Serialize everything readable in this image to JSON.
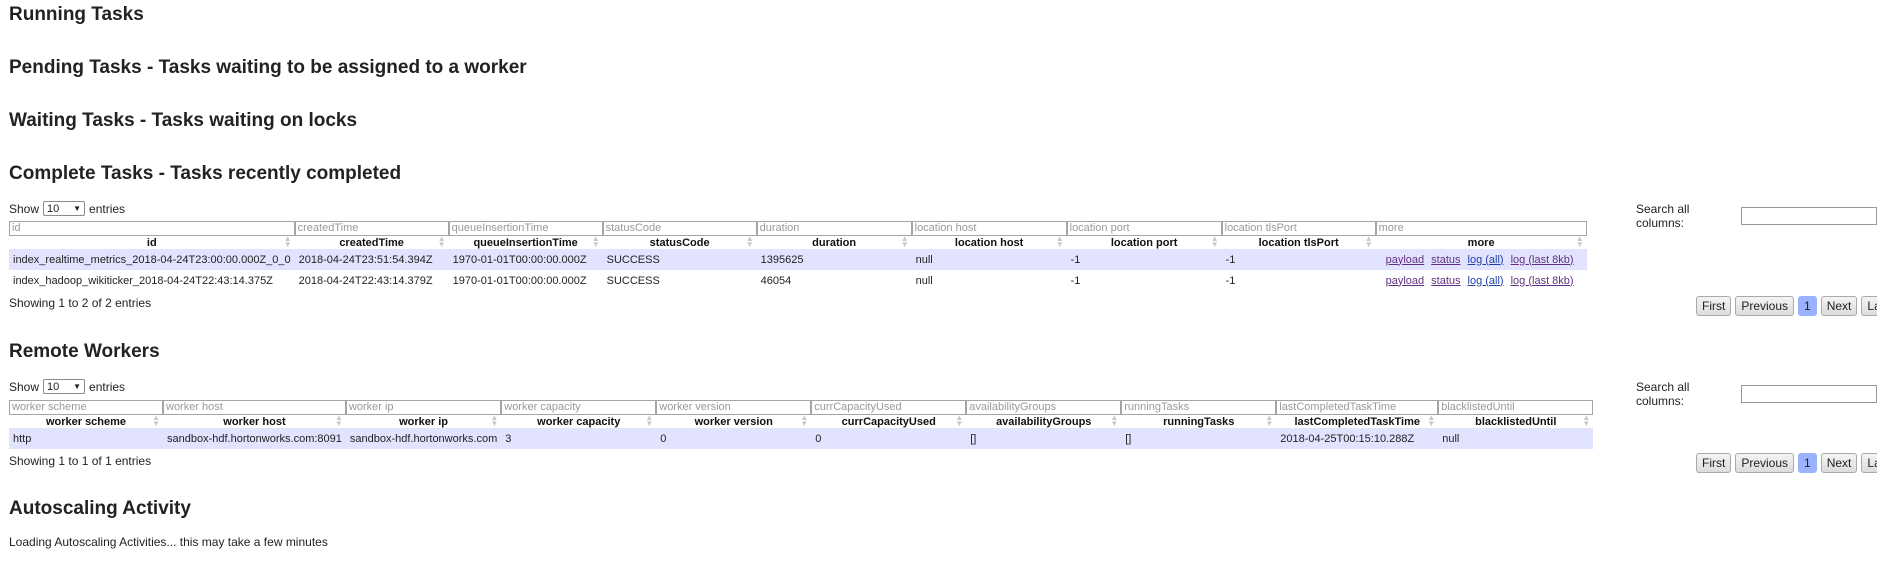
{
  "sections": {
    "running": "Running Tasks",
    "pending": "Pending Tasks - Tasks waiting to be assigned to a worker",
    "waiting": "Waiting Tasks - Tasks waiting on locks",
    "complete": "Complete Tasks - Tasks recently completed",
    "remote": "Remote Workers",
    "autoscaling": "Autoscaling Activity"
  },
  "common": {
    "show": "Show",
    "entries": "entries",
    "page_size": "10",
    "search_label": "Search all columns:",
    "first": "First",
    "previous": "Previous",
    "page": "1",
    "next": "Next",
    "last": "La"
  },
  "complete_table": {
    "filters": [
      "id",
      "createdTime",
      "queueInsertionTime",
      "statusCode",
      "duration",
      "location host",
      "location port",
      "location tlsPort",
      "more"
    ],
    "headers": [
      "id",
      "createdTime",
      "queueInsertionTime",
      "statusCode",
      "duration",
      "location host",
      "location port",
      "location tlsPort",
      "more"
    ],
    "rows": [
      {
        "id": "index_realtime_metrics_2018-04-24T23:00:00.000Z_0_0",
        "createdTime": "2018-04-24T23:51:54.394Z",
        "queueInsertionTime": "1970-01-01T00:00:00.000Z",
        "statusCode": "SUCCESS",
        "duration": "1395625",
        "host": "null",
        "port": "-1",
        "tlsPort": "-1"
      },
      {
        "id": "index_hadoop_wikiticker_2018-04-24T22:43:14.375Z",
        "createdTime": "2018-04-24T22:43:14.379Z",
        "queueInsertionTime": "1970-01-01T00:00:00.000Z",
        "statusCode": "SUCCESS",
        "duration": "46054",
        "host": "null",
        "port": "-1",
        "tlsPort": "-1"
      }
    ],
    "links": {
      "payload": "payload",
      "status": "status",
      "log_all": "log (all)",
      "log_last": "log (last 8kb)"
    },
    "info": "Showing 1 to 2 of 2 entries"
  },
  "workers_table": {
    "filters": [
      "worker scheme",
      "worker host",
      "worker ip",
      "worker capacity",
      "worker version",
      "currCapacityUsed",
      "availabilityGroups",
      "runningTasks",
      "lastCompletedTaskTime",
      "blacklistedUntil"
    ],
    "headers": [
      "worker scheme",
      "worker host",
      "worker ip",
      "worker capacity",
      "worker version",
      "currCapacityUsed",
      "availabilityGroups",
      "runningTasks",
      "lastCompletedTaskTime",
      "blacklistedUntil"
    ],
    "row": {
      "scheme": "http",
      "host": "sandbox-hdf.hortonworks.com:8091",
      "ip": "sandbox-hdf.hortonworks.com",
      "capacity": "3",
      "version": "0",
      "used": "0",
      "groups": "[]",
      "running": "[]",
      "lastCompleted": "2018-04-25T00:15:10.288Z",
      "blacklisted": "null"
    },
    "info": "Showing 1 to 1 of 1 entries"
  },
  "autoscaling": {
    "message": "Loading Autoscaling Activities... this may take a few minutes"
  }
}
